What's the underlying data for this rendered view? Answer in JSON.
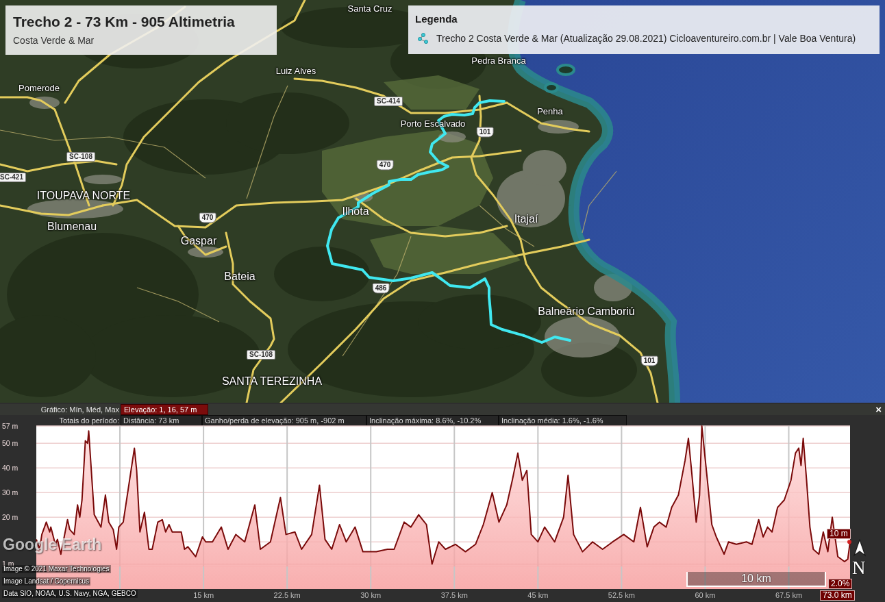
{
  "title_box": {
    "title": "Trecho 2 - 73 Km - 905 Altimetria",
    "subtitle": "Costa Verde & Mar"
  },
  "legend": {
    "heading": "Legenda",
    "items": [
      {
        "label": "Trecho 2 Costa Verde & Mar (Atualização 29.08.2021) Cicloaventureiro.com.br | Vale Boa Ventura)"
      }
    ]
  },
  "map": {
    "labels": [
      {
        "text": "Santa Cruz",
        "kind": "town"
      },
      {
        "text": "Pedra Branca",
        "kind": "town"
      },
      {
        "text": "Luiz Alves",
        "kind": "town"
      },
      {
        "text": "Pomerode",
        "kind": "town"
      },
      {
        "text": "SC-414",
        "kind": "state"
      },
      {
        "text": "Penha",
        "kind": "town"
      },
      {
        "text": "Porto Escalvado",
        "kind": "town"
      },
      {
        "text": "101",
        "kind": "federal"
      },
      {
        "text": "SC-108",
        "kind": "state"
      },
      {
        "text": "470",
        "kind": "federal"
      },
      {
        "text": "SC-421",
        "kind": "state"
      },
      {
        "text": "ITOUPAVA NORTE",
        "kind": "city"
      },
      {
        "text": "Ilhota",
        "kind": "city"
      },
      {
        "text": "470",
        "kind": "federal"
      },
      {
        "text": "Itajaí",
        "kind": "city"
      },
      {
        "text": "Blumenau",
        "kind": "city"
      },
      {
        "text": "Gaspar",
        "kind": "city"
      },
      {
        "text": "Bateia",
        "kind": "city"
      },
      {
        "text": "486",
        "kind": "federal"
      },
      {
        "text": "Balneário Camboriú",
        "kind": "city"
      },
      {
        "text": "SC-108",
        "kind": "state"
      },
      {
        "text": "101",
        "kind": "federal"
      },
      {
        "text": "SANTA TEREZINHA",
        "kind": "city"
      }
    ]
  },
  "elevation_panel": {
    "summary_label": "Gráfico: Mín, Méd, Max",
    "summary_value": "Elevação: 1, 16, 57 m",
    "totals_label": "Totais do período:",
    "totals": [
      "Distância: 73 km",
      "Ganho/perda de elevação: 905 m, -902 m",
      "Inclinação máxima: 8.6%, -10.2%",
      "Inclinação média: 1.6%, -1.6%"
    ],
    "close": "×",
    "chart_data": {
      "type": "area",
      "grid": true,
      "x": [
        0,
        0.3,
        0.5,
        0.9,
        1.2,
        1.3,
        1.7,
        1.9,
        2.2,
        2.8,
        3,
        3.4,
        3.7,
        3.9,
        4.1,
        4.4,
        4.6,
        4.7,
        5.2,
        5.8,
        6.2,
        6.5,
        6.9,
        7.2,
        7.4,
        7.8,
        8.1,
        8.5,
        8.8,
        9,
        9.3,
        9.7,
        10.1,
        10.4,
        10.9,
        11.3,
        11.6,
        11.9,
        12.2,
        12.5,
        13,
        13.3,
        13.6,
        14.3,
        14.9,
        15.2,
        15.8,
        16.6,
        17.2,
        17.9,
        18.7,
        19.6,
        20.1,
        21,
        21.9,
        22.4,
        23.2,
        23.8,
        24.7,
        25.4,
        25.9,
        26.5,
        27.2,
        27.8,
        28.6,
        29.3,
        30.5,
        31.5,
        32.1,
        33,
        33.6,
        34.3,
        35,
        35.5,
        36.1,
        36.7,
        37.6,
        38.5,
        39.4,
        40.1,
        40.9,
        41.5,
        42.2,
        42.7,
        43.2,
        43.6,
        44,
        44.4,
        45,
        45.6,
        46.5,
        47.3,
        47.7,
        48.2,
        49,
        49.9,
        50.8,
        51.7,
        52.7,
        53.6,
        54.2,
        54.8,
        55.4,
        55.9,
        56.5,
        57,
        57.6,
        58.2,
        58.5,
        58.8,
        59.2,
        59.5,
        59.7,
        60.2,
        60.6,
        61,
        61.7,
        62.1,
        62.8,
        63.7,
        64.2,
        64.8,
        65.2,
        65.6,
        66,
        66.5,
        67.1,
        67.7,
        68.1,
        68.4,
        68.6,
        68.8,
        69.1,
        69.4,
        69.7,
        70.2,
        70.6,
        71,
        71.4,
        71.9,
        72.5,
        72.8,
        73
      ],
      "series": [
        {
          "color": "#7a0a0a",
          "values": [
            11,
            7,
            13,
            18,
            14,
            16,
            9,
            11,
            5,
            19,
            15,
            13,
            25,
            20,
            27,
            51,
            50,
            55,
            21,
            16,
            29,
            18,
            15,
            7,
            16,
            18,
            27,
            39,
            48,
            39,
            14,
            22,
            7,
            7,
            18,
            19,
            14,
            17,
            14,
            14,
            14,
            7,
            8,
            4,
            12,
            10,
            10,
            16,
            7,
            13,
            10,
            25,
            7,
            10,
            28,
            13,
            14,
            7,
            13,
            33,
            11,
            7,
            17,
            10,
            16,
            6,
            6,
            7,
            7,
            18,
            16,
            21,
            17,
            1,
            10,
            7,
            9,
            6,
            9,
            17,
            30,
            18,
            25,
            35,
            46,
            35,
            39,
            13,
            10,
            16,
            10,
            20,
            37,
            13,
            6,
            10,
            7,
            10,
            13,
            10,
            24,
            8,
            16,
            18,
            16,
            24,
            29,
            43,
            52,
            38,
            18,
            29,
            57,
            35,
            17,
            12,
            5,
            10,
            9,
            10,
            9,
            19,
            12,
            16,
            14,
            24,
            27,
            35,
            46,
            48,
            41,
            52,
            35,
            16,
            7,
            5,
            14,
            6,
            20,
            4,
            2,
            3,
            10
          ]
        }
      ],
      "xlim": [
        0,
        73
      ],
      "ylim": [
        -9.1,
        57
      ],
      "xticks": [
        {
          "value": 15,
          "label": "15 km"
        },
        {
          "value": 22.5,
          "label": "22.5 km"
        },
        {
          "value": 30,
          "label": "30 km"
        },
        {
          "value": 37.5,
          "label": "37.5 km"
        },
        {
          "value": 45,
          "label": "45 km"
        },
        {
          "value": 52.5,
          "label": "52.5 km"
        },
        {
          "value": 60,
          "label": "60 km"
        },
        {
          "value": 67.5,
          "label": "67.5 km"
        }
      ],
      "yticks": [
        {
          "value": 1,
          "label": "1 m"
        },
        {
          "value": 20,
          "label": "20 m"
        },
        {
          "value": 30,
          "label": "30 m"
        },
        {
          "value": 40,
          "label": "40 m"
        },
        {
          "value": 50,
          "label": "50 m"
        },
        {
          "value": 57,
          "label": "57 m"
        }
      ]
    },
    "cursor": {
      "elevation": "10 m",
      "slope": "2.0%",
      "distance": "73.0 km"
    }
  },
  "overlays": {
    "logo": "Google Earth",
    "credits": [
      "Image © 2021 Maxar Technologies",
      "Image Landsat / Copernicus",
      "Data SIO, NOAA, U.S. Navy, NGA, GEBCO"
    ],
    "scale_bar": "10 km",
    "compass": "N"
  }
}
